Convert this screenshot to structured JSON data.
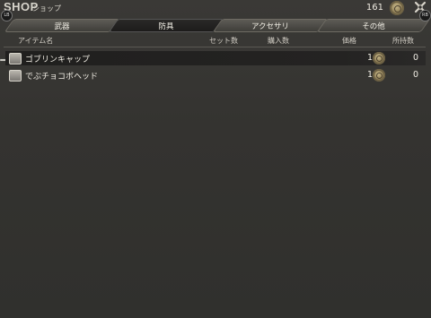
{
  "header": {
    "title": "SHOP",
    "subtitle": "ショップ",
    "gil": "161"
  },
  "tabs": [
    {
      "label": "武器",
      "active": false
    },
    {
      "label": "防具",
      "active": true
    },
    {
      "label": "アクセサリ",
      "active": false
    },
    {
      "label": "その他",
      "active": false
    }
  ],
  "shoulder": {
    "left": "LB",
    "right": "RB"
  },
  "columns": {
    "name": "アイテム名",
    "set_count": "セット数",
    "buy_count": "購入数",
    "price": "価格",
    "owned": "所持数"
  },
  "items": [
    {
      "name": "ゴブリンキャップ",
      "price": "1",
      "owned": "0",
      "selected": true
    },
    {
      "name": "でぶチョコボヘッド",
      "price": "1",
      "owned": "0",
      "selected": false
    }
  ]
}
